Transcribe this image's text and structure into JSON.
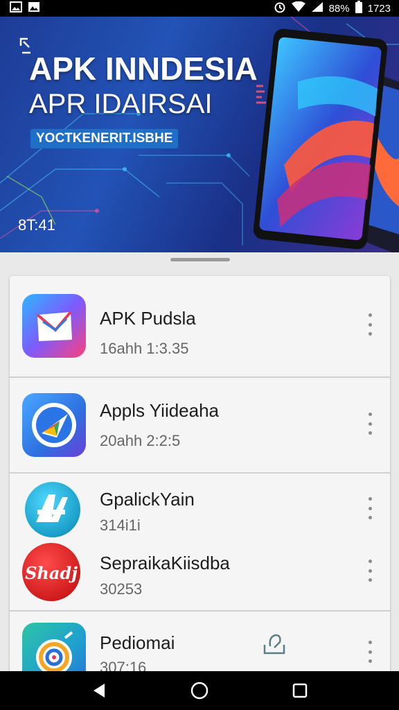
{
  "status_bar": {
    "left_icons": [
      "gallery-icon",
      "image-icon"
    ],
    "battery_percent": "88%",
    "time": "1723",
    "right_icons": [
      "alarm-icon",
      "wifi-icon",
      "signal-icon",
      "battery-icon"
    ]
  },
  "banner": {
    "title_line1": "APK INNDESIA",
    "title_line2": "APR IDAIRSAI",
    "tagline": "YOCTKENERIT.ISBHE",
    "time_text": "8T:41",
    "colors": {
      "background": "#2253b6",
      "tag": "#1f6fc8"
    }
  },
  "apps": [
    {
      "title": "APK Pudsla",
      "subtitle": "16ahh 1:3.35",
      "icon": "mail-envelope-icon"
    },
    {
      "title": "Appls Yiideaha",
      "subtitle": "20ahh 2:2:5",
      "icon": "compass-arrow-icon"
    },
    {
      "title": "GpalickYain",
      "subtitle": "314i1i",
      "icon": "blue-letter-icon"
    },
    {
      "title": "SepraikaKiisdba",
      "subtitle": "30253",
      "icon": "shadi-logo-icon"
    },
    {
      "title": "Pediomai",
      "subtitle": "307:16",
      "icon": "target-ring-icon"
    }
  ],
  "app_icon_text": {
    "shadi": "Shadj"
  },
  "nav_bar": {
    "buttons": [
      "back-icon",
      "home-icon",
      "recents-icon"
    ]
  }
}
